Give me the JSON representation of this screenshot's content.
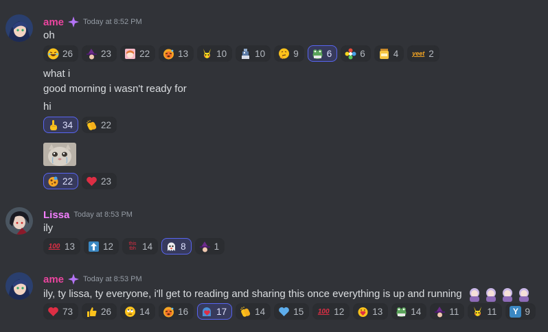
{
  "colors": {
    "ame": "#eb459f",
    "lissa": "#f47fff",
    "accent": "#5865f2"
  },
  "messages": [
    {
      "author": "ame",
      "timestamp": "Today at 8:52 PM",
      "lines": [
        "oh"
      ],
      "reactions": [
        {
          "icon": "laughing-emoji",
          "count": "26",
          "me": false
        },
        {
          "icon": "witch-emote",
          "count": "23",
          "me": false
        },
        {
          "icon": "anime-girl-emote",
          "count": "22",
          "me": false
        },
        {
          "icon": "hot-face-emoji",
          "count": "13",
          "me": false
        },
        {
          "icon": "pikachu-emote",
          "count": "10",
          "me": false
        },
        {
          "icon": "pixel-character-emote",
          "count": "10",
          "me": false
        },
        {
          "icon": "thinking-emoji",
          "count": "9",
          "me": false
        },
        {
          "icon": "frog-emote",
          "count": "6",
          "me": true
        },
        {
          "icon": "colorful-flower-emote",
          "count": "6",
          "me": false
        },
        {
          "icon": "jar-emote",
          "count": "4",
          "me": false
        },
        {
          "icon": "yeet-text-emote",
          "text": "yeet",
          "count": "2",
          "me": false
        }
      ]
    },
    {
      "lines": [
        "what i",
        "good morning i wasn't ready for",
        "hi"
      ],
      "reactions": [
        {
          "icon": "point-up-emoji",
          "count": "34",
          "me": true
        },
        {
          "icon": "clapping-hands-emoji",
          "count": "22",
          "me": false
        }
      ]
    },
    {
      "image": "crying-cat-image",
      "reactions": [
        {
          "icon": "cookie-emote",
          "count": "22",
          "me": true
        },
        {
          "icon": "red-heart-emoji",
          "count": "23",
          "me": false
        }
      ]
    },
    {
      "author": "Lissa",
      "timestamp": "Today at 8:53 PM",
      "lines": [
        "ily"
      ],
      "reactions": [
        {
          "icon": "hundred-points-emoji",
          "text": "100",
          "count": "13",
          "me": false
        },
        {
          "icon": "up-arrow-emoji",
          "count": "12",
          "me": false
        },
        {
          "icon": "this-tbh-emote",
          "text": "this tbh",
          "count": "14",
          "me": false
        },
        {
          "icon": "ghost-emote",
          "count": "8",
          "me": true
        },
        {
          "icon": "witch-emote",
          "count": "1",
          "me": false
        }
      ]
    },
    {
      "author": "ame",
      "timestamp": "Today at 8:53 PM",
      "lines": [
        "ily, ty lissa, ty everyone, i'll get to reading and sharing this once everything is up and running"
      ],
      "reactions": [
        {
          "icon": "red-heart-emoji",
          "count": "73",
          "me": false
        },
        {
          "icon": "thumbs-up-emoji",
          "count": "26",
          "me": false
        },
        {
          "icon": "rolling-eyes-emoji",
          "count": "14",
          "me": false
        },
        {
          "icon": "hot-face-emoji",
          "count": "16",
          "me": false
        },
        {
          "icon": "ghost-heart-emote",
          "count": "17",
          "me": true
        },
        {
          "icon": "clapping-hands-emoji",
          "count": "14",
          "me": false
        },
        {
          "icon": "blue-heart-emoji",
          "count": "15",
          "me": false
        },
        {
          "icon": "hundred-points-emoji",
          "text": "100",
          "count": "12",
          "me": false
        },
        {
          "icon": "heart-hug-emote",
          "count": "13",
          "me": false
        },
        {
          "icon": "frog-emote",
          "count": "14",
          "me": false
        },
        {
          "icon": "witch-emote",
          "count": "11",
          "me": false
        },
        {
          "icon": "pikachu-emote",
          "count": "11",
          "me": false
        },
        {
          "icon": "y-letter-emote",
          "text": "Y",
          "count": "9",
          "me": false
        }
      ]
    }
  ]
}
